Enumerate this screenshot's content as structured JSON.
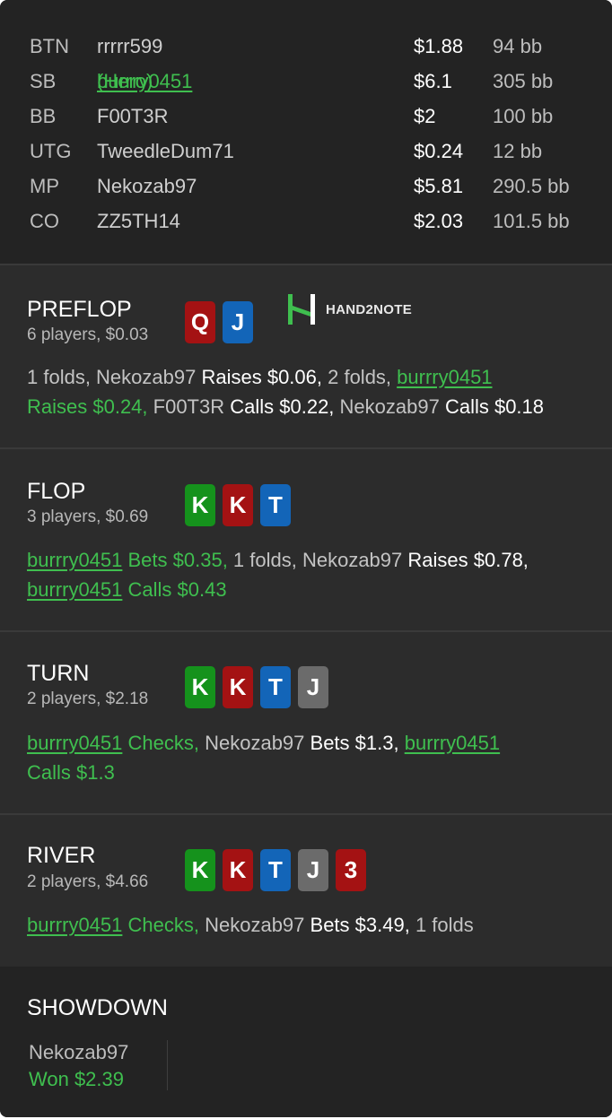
{
  "players": [
    {
      "pos": "BTN",
      "name": "rrrrr599",
      "stack": "$1.88",
      "bb": "94 bb"
    },
    {
      "pos": "SB",
      "name": "burrry0451",
      "tag": "(Hero)",
      "stack": "$6.1",
      "bb": "305 bb"
    },
    {
      "pos": "BB",
      "name": "F00T3R",
      "stack": "$2",
      "bb": "100 bb"
    },
    {
      "pos": "UTG",
      "name": "TweedleDum71",
      "stack": "$0.24",
      "bb": "12 bb"
    },
    {
      "pos": "MP",
      "name": "Nekozab97",
      "stack": "$5.81",
      "bb": "290.5 bb"
    },
    {
      "pos": "CO",
      "name": "ZZ5TH14",
      "stack": "$2.03",
      "bb": "101.5 bb"
    }
  ],
  "logo_text": "HAND2NOTE",
  "colors": {
    "hero_green": "#3fbf4f",
    "card_red": "#a41213",
    "card_blue": "#1365b8",
    "card_green": "#15921c",
    "card_grey": "#6b6b6b"
  },
  "streets": {
    "preflop": {
      "title": "PREFLOP",
      "sub": "6 players, $0.03",
      "cards": [
        {
          "rank": "Q",
          "suit": "red"
        },
        {
          "rank": "J",
          "suit": "blue"
        }
      ],
      "a1": "1 folds, Nekozab97 ",
      "a2": "Raises $0.06,",
      "a3": " 2 folds, ",
      "a4": "burrry0451",
      "a5": "Raises $0.24,",
      "a6": " F00T3R ",
      "a7": "Calls $0.22,",
      "a8": " Nekozab97 ",
      "a9": "Calls $0.18"
    },
    "flop": {
      "title": "FLOP",
      "sub": "3 players, $0.69",
      "cards": [
        {
          "rank": "K",
          "suit": "green"
        },
        {
          "rank": "K",
          "suit": "red"
        },
        {
          "rank": "T",
          "suit": "blue"
        }
      ],
      "a1": "burrry0451",
      "a2": " Bets $0.35,",
      "a3": " 1 folds, Nekozab97 ",
      "a4": "Raises $0.78,",
      "a5": "burrry0451",
      "a6": " Calls $0.43"
    },
    "turn": {
      "title": "TURN",
      "sub": "2 players, $2.18",
      "cards": [
        {
          "rank": "K",
          "suit": "green"
        },
        {
          "rank": "K",
          "suit": "red"
        },
        {
          "rank": "T",
          "suit": "blue"
        },
        {
          "rank": "J",
          "suit": "grey"
        }
      ],
      "a1": "burrry0451",
      "a2": " Checks,",
      "a3": " Nekozab97 ",
      "a4": "Bets $1.3,",
      "a5": "burrry0451",
      "a6": "Calls $1.3"
    },
    "river": {
      "title": "RIVER",
      "sub": "2 players, $4.66",
      "cards": [
        {
          "rank": "K",
          "suit": "green"
        },
        {
          "rank": "K",
          "suit": "red"
        },
        {
          "rank": "T",
          "suit": "blue"
        },
        {
          "rank": "J",
          "suit": "grey"
        },
        {
          "rank": "3",
          "suit": "red"
        }
      ],
      "a1": "burrry0451",
      "a2": " Checks,",
      "a3": " Nekozab97 ",
      "a4": "Bets $3.49,",
      "a5": " 1 folds"
    }
  },
  "showdown": {
    "title": "SHOWDOWN",
    "name": "Nekozab97",
    "result": "Won $2.39"
  }
}
